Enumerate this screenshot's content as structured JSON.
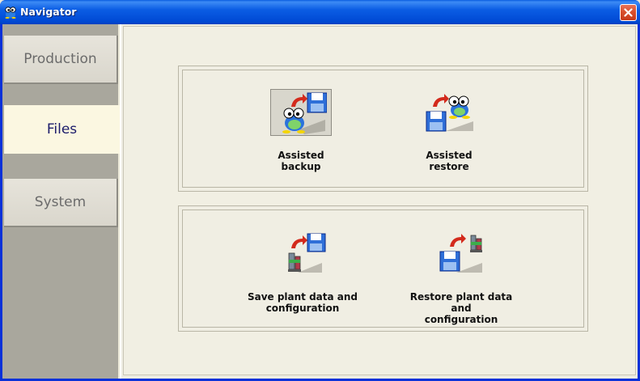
{
  "window": {
    "title": "Navigator",
    "app_icon": "frog-mascot-icon",
    "close_icon": "close-icon"
  },
  "sidebar": {
    "items": [
      {
        "label": "Production",
        "active": false
      },
      {
        "label": "Files",
        "active": true
      },
      {
        "label": "System",
        "active": false
      }
    ]
  },
  "groups": [
    {
      "items": [
        {
          "label": "Assisted backup",
          "icon": "backup-mascot-to-disk-icon",
          "selected": true
        },
        {
          "label": "Assisted restore",
          "icon": "restore-disk-to-mascot-icon",
          "selected": false
        }
      ]
    },
    {
      "items": [
        {
          "label_line1": "Save plant data and",
          "label_line2": "configuration",
          "icon": "save-plant-data-icon"
        },
        {
          "label_line1": "Restore plant data and",
          "label_line2": "configuration",
          "icon": "restore-plant-data-icon"
        }
      ]
    }
  ],
  "colors": {
    "titlebar": "#0b5de4",
    "sidebar_bg": "#a9a79d",
    "active_tab_bg": "#fbf7e1",
    "active_tab_text": "#1b1b6a",
    "inactive_tab_text": "#6b6b6b",
    "panel_bg": "#f1efe3"
  }
}
